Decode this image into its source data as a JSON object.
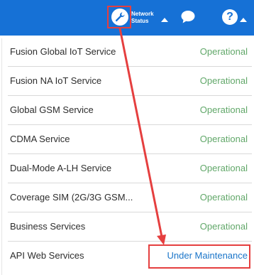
{
  "topbar": {
    "network_status_line1": "Network",
    "network_status_line2": "Status",
    "help_symbol": "?"
  },
  "icons": {
    "wrench": "wrench-icon",
    "chat": "chat-bubble-icon",
    "help": "help-icon"
  },
  "colors": {
    "topbar": "#1671d6",
    "operational": "#62a86a",
    "maintenance": "#1a75c9",
    "annotation": "#e53f3f"
  },
  "services": [
    {
      "name": "Fusion Global IoT Service",
      "status": "Operational"
    },
    {
      "name": "Fusion NA IoT Service",
      "status": "Operational"
    },
    {
      "name": "Global GSM Service",
      "status": "Operational"
    },
    {
      "name": "CDMA Service",
      "status": "Operational"
    },
    {
      "name": "Dual-Mode A-LH Service",
      "status": "Operational"
    },
    {
      "name": "Coverage SIM (2G/3G GSM...",
      "status": "Operational"
    },
    {
      "name": "Business Services",
      "status": "Operational"
    },
    {
      "name": "API Web Services",
      "status": "Under Maintenance"
    }
  ]
}
